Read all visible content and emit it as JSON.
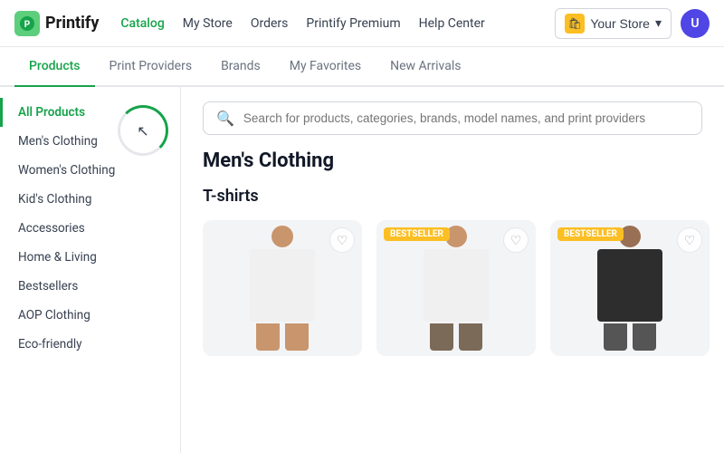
{
  "logo": {
    "icon_char": "P",
    "text": "Printify"
  },
  "top_nav": {
    "links": [
      {
        "label": "Catalog",
        "active": true
      },
      {
        "label": "My Store",
        "active": false
      },
      {
        "label": "Orders",
        "active": false
      },
      {
        "label": "Printify Premium",
        "active": false
      },
      {
        "label": "Help Center",
        "active": false
      }
    ],
    "store_button": "Your Store",
    "avatar_initials": "U"
  },
  "sub_nav": {
    "tabs": [
      {
        "label": "Products",
        "active": true
      },
      {
        "label": "Print Providers",
        "active": false
      },
      {
        "label": "Brands",
        "active": false
      },
      {
        "label": "My Favorites",
        "active": false
      },
      {
        "label": "New Arrivals",
        "active": false
      }
    ]
  },
  "sidebar": {
    "items": [
      {
        "label": "All Products",
        "active": true
      },
      {
        "label": "Men's Clothing",
        "active": false
      },
      {
        "label": "Women's Clothing",
        "active": false
      },
      {
        "label": "Kid's Clothing",
        "active": false
      },
      {
        "label": "Accessories",
        "active": false
      },
      {
        "label": "Home & Living",
        "active": false
      },
      {
        "label": "Bestsellers",
        "active": false
      },
      {
        "label": "AOP Clothing",
        "active": false
      },
      {
        "label": "Eco-friendly",
        "active": false
      }
    ]
  },
  "search": {
    "placeholder": "Search for products, categories, brands, model names, and print providers"
  },
  "main": {
    "section_title": "Men's Clothing",
    "subsection_title": "T-shirts",
    "products": [
      {
        "badge": null,
        "type": "white"
      },
      {
        "badge": "Bestseller",
        "type": "white"
      },
      {
        "badge": "Bestseller",
        "type": "black"
      }
    ]
  },
  "badges": {
    "bestseller": "Bestseller"
  }
}
